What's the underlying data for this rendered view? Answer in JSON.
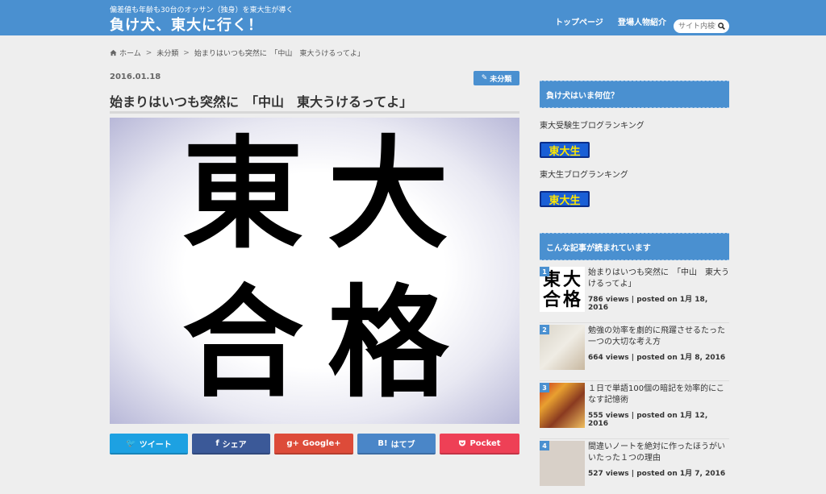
{
  "header": {
    "tagline": "偏差値も年齢も30台のオッサン（独身）を東大生が導く",
    "site_title": "負け犬、東大に行く！",
    "nav": [
      "トップページ",
      "登場人物紹介"
    ],
    "search_placeholder": "サイト内検索"
  },
  "breadcrumb": {
    "home": "ホーム",
    "category": "未分類",
    "current": "始まりはいつも突然に　「中山　東大うけるってよ」"
  },
  "article": {
    "date": "2016.01.18",
    "category_badge": "未分類",
    "title": "始まりはいつも突然に　「中山　東大うけるってよ」",
    "hero_chars": [
      "東",
      "大",
      "合",
      "格"
    ]
  },
  "share": {
    "twitter": "ツイート",
    "facebook": "シェア",
    "google": "Google+",
    "hatena": "はてブ",
    "hatena_icon": "B!",
    "pocket": "Pocket"
  },
  "sidebar": {
    "ranking_widget": {
      "title": "負け犬はいま何位？",
      "items": [
        {
          "label": "東大受験生ブログランキング",
          "banner": "東大生"
        },
        {
          "label": "東大生ブログランキング",
          "banner": "東大生"
        }
      ]
    },
    "popular_widget": {
      "title": "こんな記事が読まれています",
      "items": [
        {
          "rank": "1",
          "title": "始まりはいつも突然に　「中山　東大うけるってよ」",
          "views": "786 views",
          "posted": " | posted on 1月 18, 2016"
        },
        {
          "rank": "2",
          "title": "勉強の効率を劇的に飛躍させるたった一つの大切な考え方",
          "views": "664 views",
          "posted": " | posted on 1月 8, 2016"
        },
        {
          "rank": "3",
          "title": "１日で単語100個の暗記を効率的にこなす記憶術",
          "views": "555 views",
          "posted": " | posted on 1月 12, 2016"
        },
        {
          "rank": "4",
          "title": "間違いノートを絶対に作ったほうがいいたった１つの理由",
          "views": "527 views",
          "posted": " | posted on 1月 7, 2016"
        }
      ]
    }
  },
  "colors": {
    "accent": "#4a90d0",
    "twitter": "#1da1e2",
    "facebook": "#3b5998",
    "google": "#dd4b39",
    "hatena": "#4a86c8",
    "pocket": "#ee4056"
  }
}
